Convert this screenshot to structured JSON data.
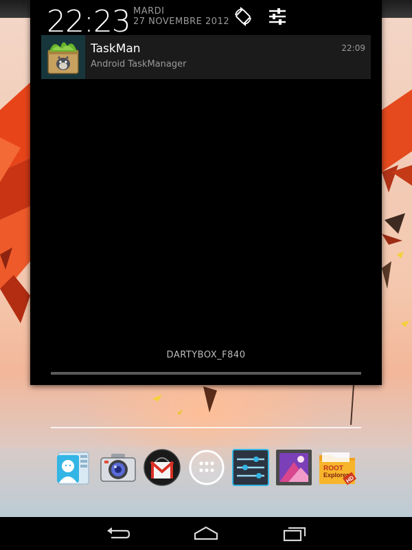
{
  "status": {
    "time": "22:23",
    "day": "MARDI",
    "date": "27 NOVEMBRE 2012"
  },
  "header_icons": {
    "rotate": "auto-rotate-icon",
    "settings": "quick-settings-icon"
  },
  "notification": {
    "app_name": "TaskMan",
    "subtitle": "Android TaskManager",
    "time": "22:09",
    "icon": "taskman-app-icon"
  },
  "carrier": "DARTYBOX_F840",
  "dock": {
    "apps": [
      {
        "name": "contacts",
        "icon": "contacts-icon"
      },
      {
        "name": "camera",
        "icon": "camera-icon"
      },
      {
        "name": "gmail",
        "icon": "gmail-icon"
      },
      {
        "name": "all-apps",
        "icon": "app-drawer-icon"
      },
      {
        "name": "settings",
        "icon": "settings-sliders-icon"
      },
      {
        "name": "gallery",
        "icon": "gallery-icon"
      },
      {
        "name": "root-explorer",
        "icon": "root-explorer-icon",
        "label_line1": "ROOT",
        "label_line2": "Explorer",
        "badge": "HD"
      }
    ]
  },
  "navigation": {
    "back": "back-icon",
    "home": "home-icon",
    "recents": "recent-apps-icon"
  },
  "colors": {
    "accent": "#33b5e5",
    "shade_bg": "#000000",
    "notif_bg": "#1b1b1b",
    "wallpaper_orange": "#e8441a"
  }
}
